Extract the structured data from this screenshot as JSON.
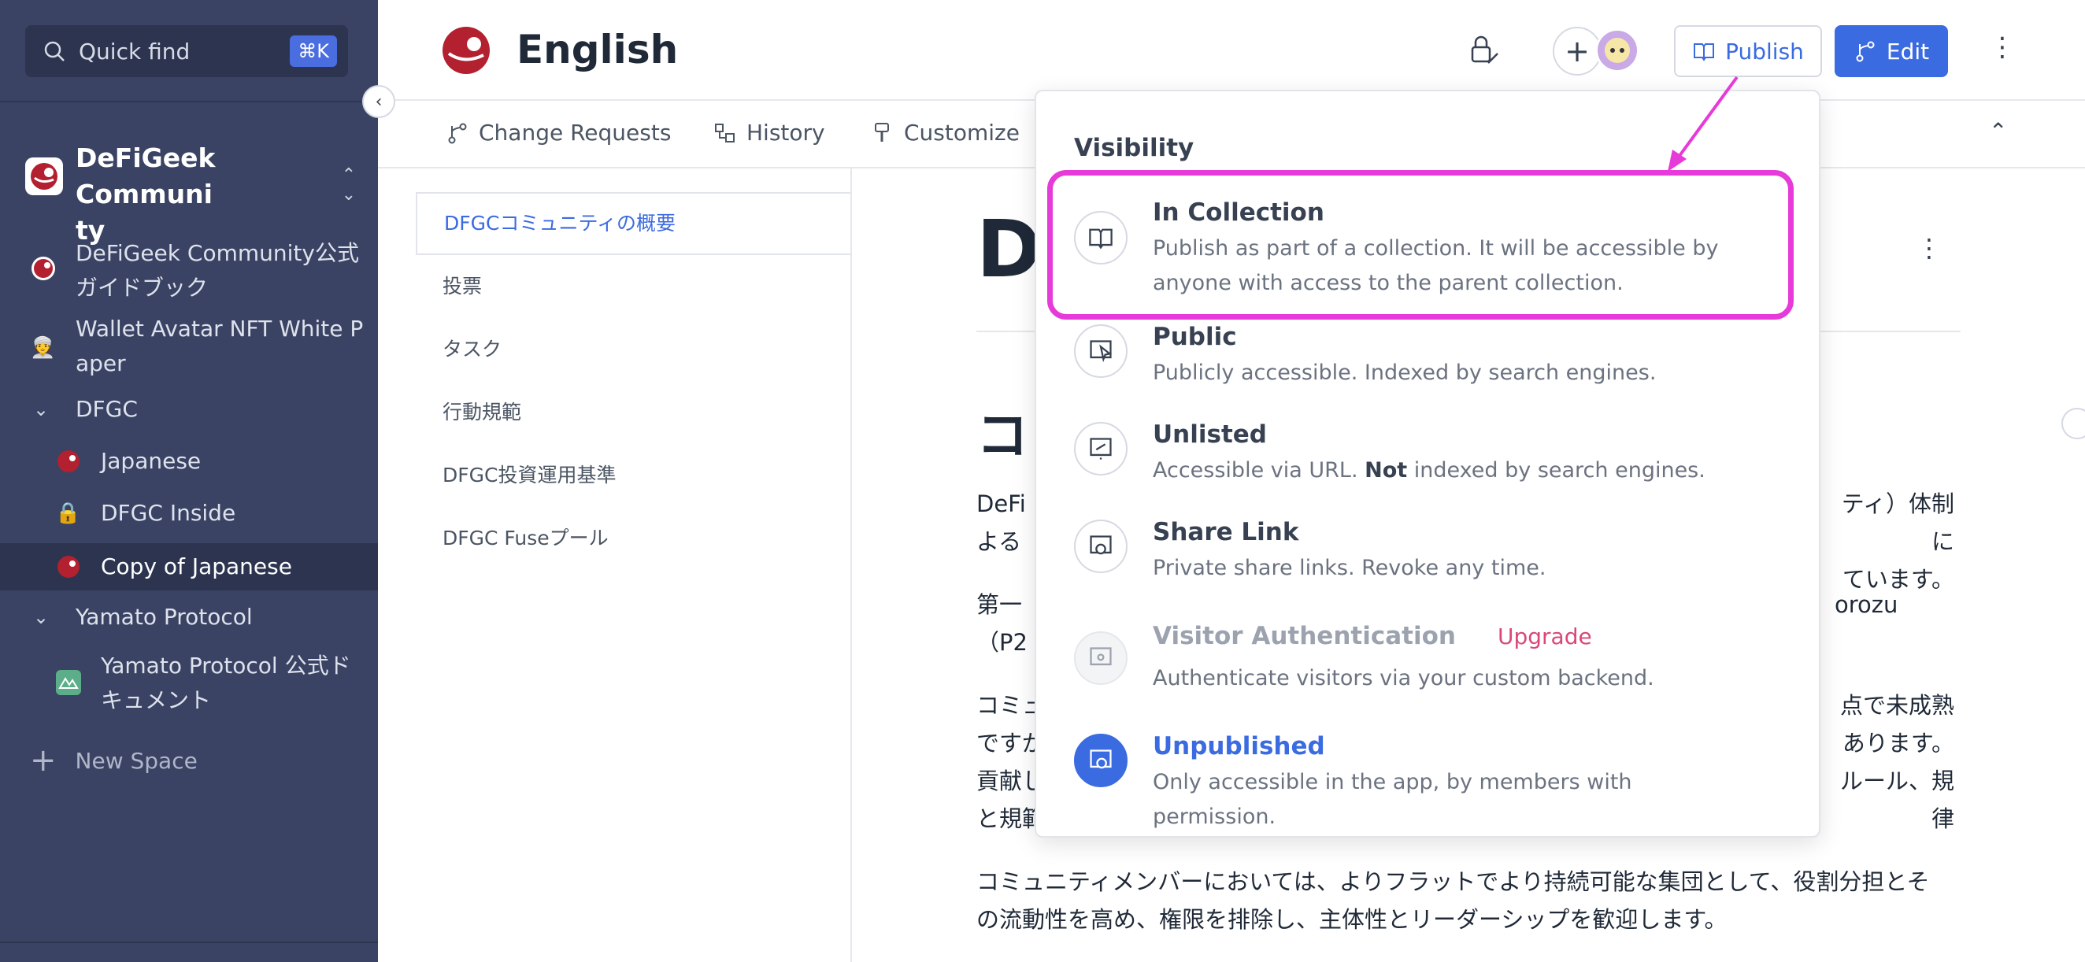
{
  "sidebar": {
    "quick_find": {
      "label": "Quick find",
      "shortcut": "⌘K"
    },
    "space": {
      "title_line1": "DeFiGeek Communi",
      "title_line2": "ty"
    },
    "items": [
      {
        "label_line1": "DeFiGeek Community公式",
        "label_line2": "ガイドブック"
      },
      {
        "label_line1": "Wallet Avatar NFT White P",
        "label_line2": "aper"
      },
      {
        "label_line1": "DFGC"
      },
      {
        "label_line1": "Japanese"
      },
      {
        "label_line1": "DFGC Inside"
      },
      {
        "label_line1": "Copy of Japanese"
      },
      {
        "label_line1": "Yamato Protocol"
      },
      {
        "label_line1": "Yamato Protocol 公式ド",
        "label_line2": "キュメント"
      }
    ],
    "new_space": "New Space"
  },
  "header": {
    "title": "English",
    "publish_label": "Publish",
    "edit_label": "Edit"
  },
  "tabs": [
    {
      "label": "Change Requests"
    },
    {
      "label": "History"
    },
    {
      "label": "Customize"
    }
  ],
  "toc": [
    {
      "label": "DFGCコミュニティの概要"
    },
    {
      "label": "投票"
    },
    {
      "label": "タスク"
    },
    {
      "label": "行動規範"
    },
    {
      "label": "DFGC投資運用基準"
    },
    {
      "label": "DFGC Fuseプール"
    }
  ],
  "main": {
    "title_fragment": "D",
    "section_fragment": "コ",
    "p1_line1_start": "DeFi",
    "p1_line1_end": "ティ）体制に",
    "p1_line2_start": "よる",
    "p1_line2_end": "ています。",
    "p2_line1_start": "第一",
    "p2_line1_end": "orozu",
    "p2_line2_start": "（P2",
    "p3_line1_start": "コミュ",
    "p3_line1_end": "点で未成熟",
    "p3_line2_start": "ですが",
    "p3_line2_end": "あります。",
    "p3_line3_start": "貢献し",
    "p3_line3_end": "ルール、規律",
    "p3_line4_start": "と規範",
    "p4_line1": "コミュニティメンバーにおいては、よりフラットでより持続可能な集団として、役割分担とそ",
    "p4_line2": "の流動性を高め、権限を排除し、主体性とリーダーシップを歓迎します。"
  },
  "visibility": {
    "heading": "Visibility",
    "options": [
      {
        "title": "In Collection",
        "desc_line1": "Publish as part of a collection. It will be accessible by",
        "desc_line2": "anyone with access to the parent collection."
      },
      {
        "title": "Public",
        "desc_line1": "Publicly accessible. Indexed by search engines."
      },
      {
        "title": "Unlisted",
        "desc_pre": "Accessible via URL. ",
        "desc_bold": "Not",
        "desc_post": " indexed by search engines."
      },
      {
        "title": "Share Link",
        "desc_line1": "Private share links. Revoke any time."
      },
      {
        "title": "Visitor Authentication",
        "badge": "Upgrade",
        "desc_line1": "Authenticate visitors via your custom backend."
      },
      {
        "title": "Unpublished",
        "desc_line1": "Only accessible in the app, by members with permission."
      }
    ]
  },
  "colors": {
    "sidebar_bg": "#3a4363",
    "accent": "#3b6be0",
    "highlight": "#e63ad9",
    "upgrade": "#d9487a",
    "brand_red": "#b3202f"
  }
}
